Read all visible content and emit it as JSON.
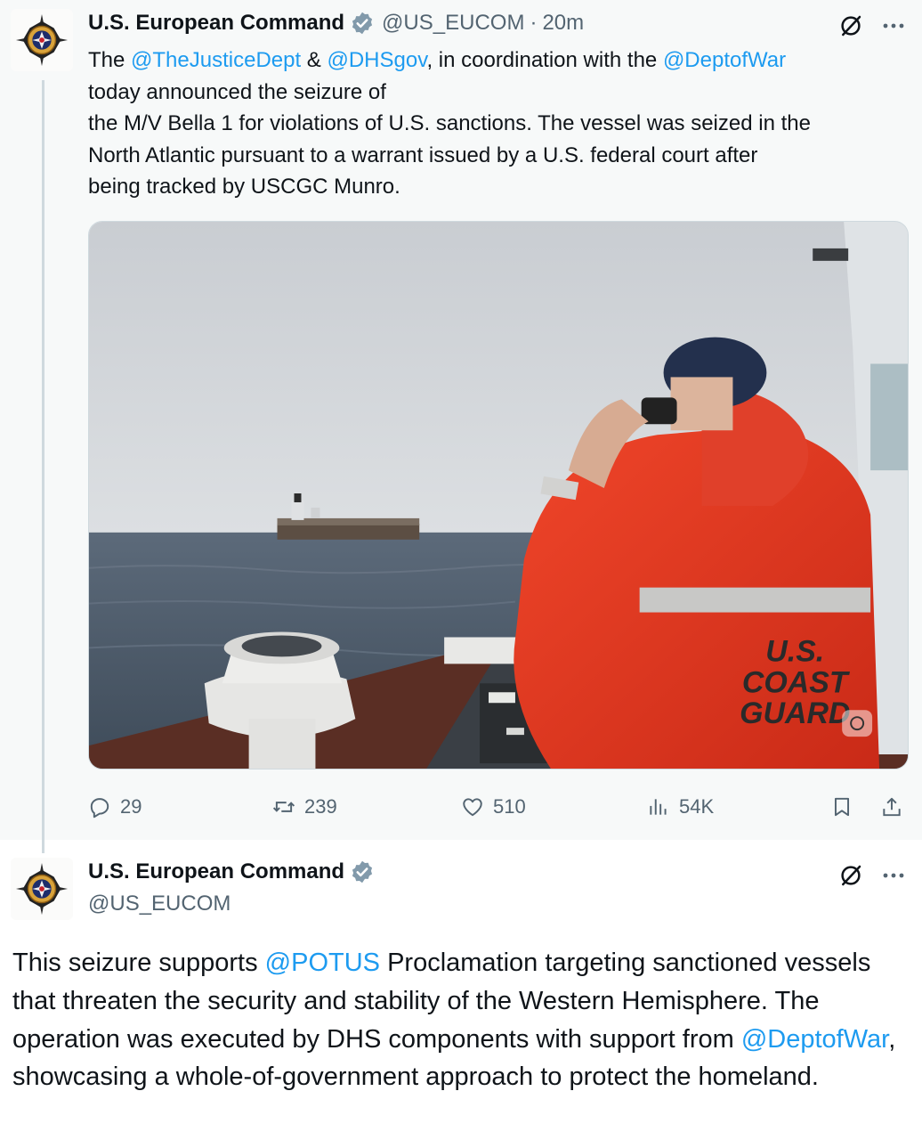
{
  "tweets": [
    {
      "author": "U.S. European Command",
      "handle": "@US_EUCOM",
      "separator": "·",
      "time": "20m",
      "line1_a": "The ",
      "mention1": "@TheJusticeDept",
      "line1_b": " & ",
      "mention2": "@DHSgov",
      "line1_c": ", in coordination with the ",
      "mention3": "@DeptofWar",
      "line2": "today announced the seizure of",
      "line3": "the M/V Bella 1 for violations of U.S. sanctions. The vessel was seized in the",
      "line4": "North Atlantic pursuant to a warrant issued by a U.S. federal court after",
      "line5": "being tracked by USCGC Munro.",
      "image_text": [
        "U.S.",
        "COAST",
        "GUARD"
      ],
      "stats": {
        "replies": "29",
        "reposts": "239",
        "likes": "510",
        "views": "54K"
      }
    },
    {
      "author": "U.S. European Command",
      "handle": "@US_EUCOM",
      "text_a": "This seizure supports ",
      "mention1": "@POTUS",
      "text_b": " Proclamation targeting sanctioned vessels that threaten the security and stability of the Western Hemisphere. The operation was executed by DHS components with support from ",
      "mention2": "@DeptofWar",
      "text_c": ", showcasing a whole-of-government approach to protect the homeland."
    }
  ],
  "colors": {
    "link": "#1d9bf0",
    "secondary_text": "#536471",
    "verified_badge": "#829aab",
    "thread_background": "#f7f9f9"
  },
  "icons": [
    "reply-icon",
    "repost-icon",
    "like-icon",
    "views-icon",
    "bookmark-icon",
    "share-icon",
    "grok-icon",
    "more-icon",
    "verified-icon"
  ]
}
